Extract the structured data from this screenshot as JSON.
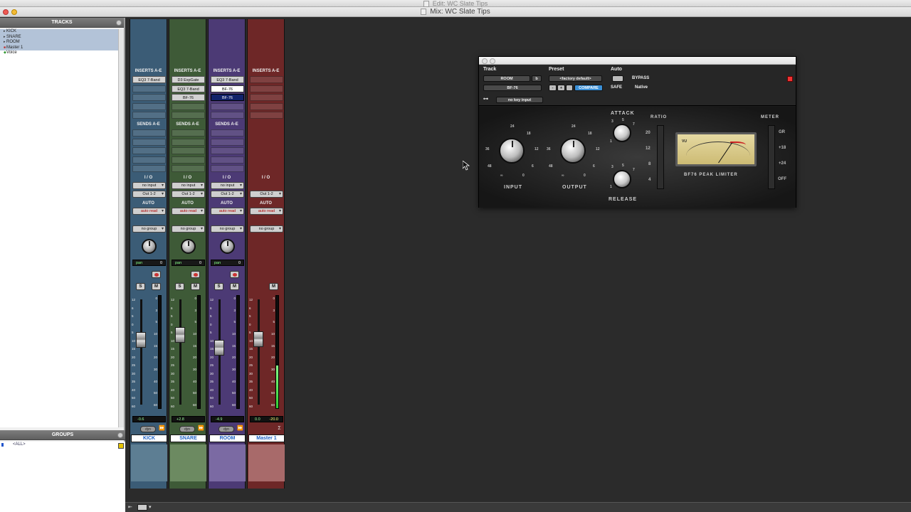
{
  "window_titles": {
    "edit": "Edit: WC Slate Tips",
    "mix": "Mix: WC Slate Tips"
  },
  "left_panel": {
    "tracks_title": "TRACKS",
    "tracks": [
      {
        "name": "KICK",
        "selected": true
      },
      {
        "name": "SNARE",
        "selected": true
      },
      {
        "name": "ROOM",
        "selected": true
      },
      {
        "name": "Master 1",
        "selected": true
      },
      {
        "name": "Voice",
        "selected": false
      }
    ],
    "groups_title": "GROUPS",
    "groups": [
      "<ALL>"
    ]
  },
  "mixer": {
    "inserts_label": "INSERTS A-E",
    "sends_label": "SENDS A-E",
    "io_label": "I / O",
    "auto_label": "AUTO",
    "pan_label": "pan",
    "solo_label": "S",
    "mute_label": "M",
    "dyn_label": "dyn",
    "fader_scale": [
      "12",
      "6",
      "5",
      "0",
      "5",
      "10",
      "15",
      "20",
      "25",
      "30",
      "35",
      "40",
      "50",
      "60"
    ],
    "meter_scale": [
      "0",
      "3",
      "5",
      "10",
      "15",
      "20",
      "30",
      "40",
      "50",
      "60"
    ],
    "strips": [
      {
        "name": "KICK",
        "color": "#3b5c76",
        "bottom_color": "#5d7e93",
        "inserts": [
          "EQ3 7-Band",
          "",
          "",
          "",
          ""
        ],
        "input": "no input",
        "output": "Out 1-2",
        "auto": "auto read",
        "group": "no group",
        "pan": "0",
        "volume": "-0.6",
        "peak": "",
        "fader_level": 0.62,
        "meter_level": 0,
        "has_rec": true
      },
      {
        "name": "SNARE",
        "color": "#3e5a37",
        "bottom_color": "#6c8a61",
        "inserts": [
          "D3 ExpGate",
          "EQ3 7-Band",
          "BF-76",
          "",
          ""
        ],
        "input": "no input",
        "output": "Out 1-2",
        "auto": "auto read",
        "group": "no group",
        "pan": "0",
        "volume": "+2.8",
        "peak": "",
        "fader_level": 0.67,
        "meter_level": 0,
        "has_rec": true
      },
      {
        "name": "ROOM",
        "color": "#4c3a75",
        "bottom_color": "#7b6aa3",
        "inserts": [
          "EQ3 7-Band",
          "BF-76",
          "BF-76",
          "",
          ""
        ],
        "input": "no input",
        "output": "Out 1-2",
        "auto": "auto read",
        "group": "no group",
        "pan": "0",
        "volume": "-4.9",
        "peak": "",
        "fader_level": 0.55,
        "meter_level": 0,
        "has_rec": true
      },
      {
        "name": "Master 1",
        "color": "#6e2727",
        "bottom_color": "#a86a6a",
        "inserts": [
          "",
          "",
          "",
          "",
          ""
        ],
        "input": "",
        "output": "Out 1-2",
        "auto": "auto read",
        "group": "no group",
        "pan": "",
        "volume": "0.0",
        "peak": "-20.0",
        "fader_level": 0.63,
        "meter_level": 0.38,
        "has_rec": false
      }
    ]
  },
  "plugin": {
    "track_label": "Track",
    "preset_label": "Preset",
    "auto_label": "Auto",
    "track_name": "ROOM",
    "track_b": "b",
    "insert_name": "BF-76",
    "preset_value": "<factory default>",
    "compare": "COMPARE",
    "minus": "-",
    "plus": "+",
    "bypass": "BYPASS",
    "safe": "SAFE",
    "native": "Native",
    "key_input": "no key input",
    "face": {
      "input": "INPUT",
      "output": "OUTPUT",
      "attack": "ATTACK",
      "release": "RELEASE",
      "ratio": "RATIO",
      "meter": "METER",
      "ratio_values": [
        "20",
        "12",
        "8",
        "4"
      ],
      "meter_values": [
        "GR",
        "+18",
        "+24",
        "OFF"
      ],
      "brand": "BF76 PEAK LIMITER",
      "vu_label": "VU",
      "knob_scale_input": [
        "24",
        "18",
        "12",
        "6",
        "36",
        "48",
        "∞",
        "0"
      ],
      "knob_scale_output": [
        "24",
        "18",
        "12",
        "6",
        "36",
        "48",
        "∞",
        "0"
      ],
      "attack_scale": [
        "3",
        "5",
        "7",
        "1"
      ],
      "release_scale": [
        "3",
        "5",
        "7",
        "1"
      ]
    }
  }
}
